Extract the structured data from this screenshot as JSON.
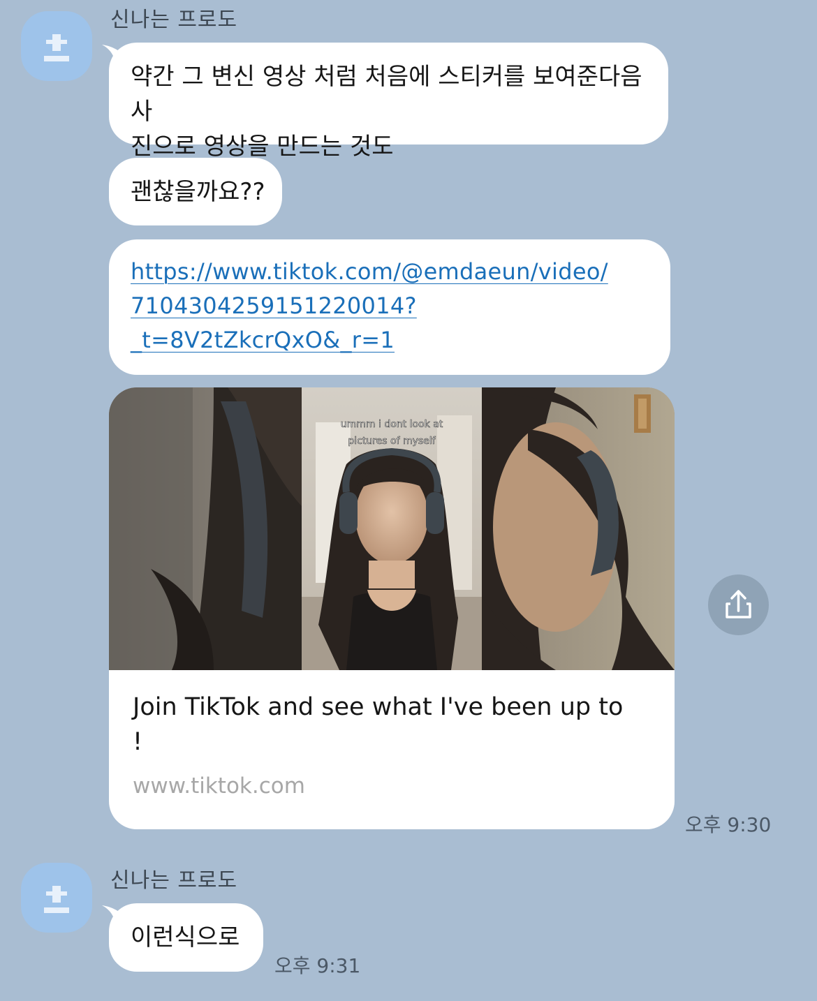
{
  "messages": [
    {
      "sender": "신나는 프로도",
      "bubbles": [
        {
          "text_line1": "약간 그 변신 영상 처럼 처음에 스티커를 보여준다음 사",
          "text_line2": "진으로 영상을 만드는 것도"
        },
        {
          "text": "괜찮을까요??"
        },
        {
          "link_line1": "https://www.tiktok.com/@emdaeun/video/",
          "link_line2": "7104304259151220014?",
          "link_line3": "_t=8V2tZkcrQxO&_r=1"
        }
      ],
      "link_preview": {
        "caption_line1": "ummm i dont look at",
        "caption_line2": "pictures of myself",
        "title_line1": "Join TikTok and see what I've been up to",
        "title_line2": "!",
        "domain": "www.tiktok.com"
      },
      "time": "오후 9:30"
    },
    {
      "sender": "신나는 프로도",
      "bubbles": [
        {
          "text": "이런식으로"
        }
      ],
      "time": "오후 9:31"
    }
  ],
  "icons": {
    "avatar": "default-profile-icon",
    "share": "share-icon"
  },
  "colors": {
    "background": "#a9bdd2",
    "avatar": "#9ec3ea",
    "link": "#1a6fb9",
    "bubble": "#ffffff"
  }
}
